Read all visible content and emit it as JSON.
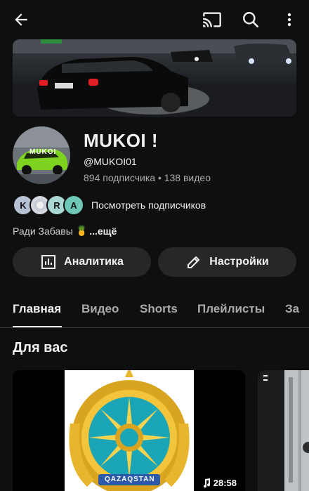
{
  "topbar": {
    "back_icon": "arrow-left-icon",
    "cast_icon": "cast-icon",
    "search_icon": "search-icon",
    "more_icon": "more-vertical-icon"
  },
  "channel": {
    "avatar_text": "MUKOI",
    "name": "MUKOI !",
    "handle": "@MUKOI01",
    "stats": "894 подписчика • 138 видео"
  },
  "subscribers": {
    "avatars": [
      {
        "letter": "K",
        "color": "#b7c1d4"
      },
      {
        "letter": "",
        "color": "#d4d8de"
      },
      {
        "letter": "R",
        "color": "#a9d8d4"
      },
      {
        "letter": "A",
        "color": "#6ec7b7"
      }
    ],
    "link": "Посмотреть подписчиков"
  },
  "description": {
    "text": "Ради Забавы",
    "emoji": "🍍",
    "more": "...ещё"
  },
  "buttons": {
    "analytics": "Аналитика",
    "settings": "Настройки"
  },
  "tabs": [
    {
      "label": "Главная",
      "active": true
    },
    {
      "label": "Видео",
      "active": false
    },
    {
      "label": "Shorts",
      "active": false
    },
    {
      "label": "Плейлисты",
      "active": false
    },
    {
      "label": "За",
      "active": false
    }
  ],
  "section": {
    "title": "Для вас"
  },
  "video_card": {
    "duration": "28:58",
    "emblem_text": "QAZAQSTAN"
  },
  "colors": {
    "background": "#0f0f0f",
    "pill": "#272727",
    "text_secondary": "#aaaaaa",
    "accent_green": "#7ed321"
  }
}
